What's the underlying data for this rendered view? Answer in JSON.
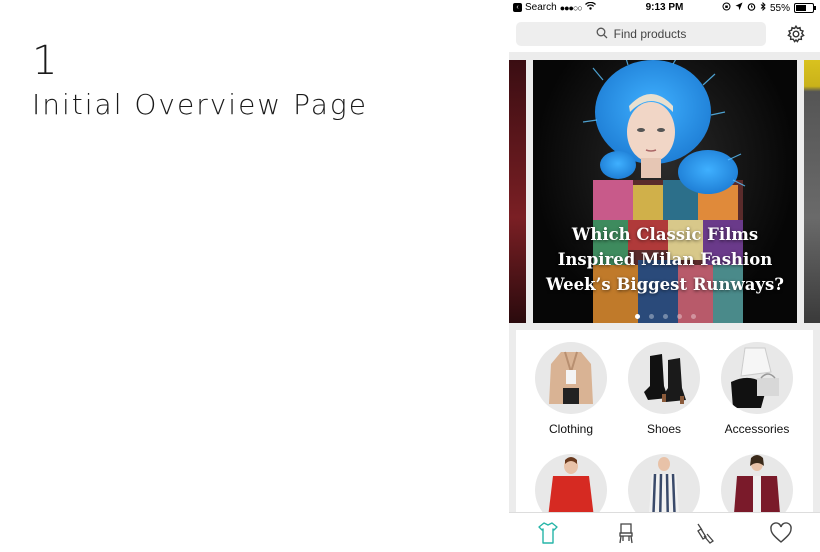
{
  "annotation": {
    "step_number": "1",
    "step_title": "Initial Overview Page"
  },
  "status_bar": {
    "back_app": "Search",
    "time": "9:13 PM",
    "battery": "55%",
    "battery_level": 0.55
  },
  "search": {
    "placeholder": "Find products"
  },
  "hero": {
    "caption_lines": [
      "Which Classic Films",
      "Inspired Milan Fashion",
      "Week’s Biggest Runways?"
    ],
    "page_count": 5,
    "active_page": 1
  },
  "categories": [
    {
      "label": "Clothing",
      "icon": "beige-coat"
    },
    {
      "label": "Shoes",
      "icon": "black-ankle-boots"
    },
    {
      "label": "Accessories",
      "icon": "handbag"
    },
    {
      "label": "",
      "icon": "red-sweater"
    },
    {
      "label": "",
      "icon": "striped-dress"
    },
    {
      "label": "",
      "icon": "burgundy-bomber-jacket"
    }
  ],
  "tabbar": {
    "items": [
      "clothing-tab",
      "furniture-tab",
      "beauty-tab",
      "favorites-tab"
    ],
    "active": "clothing-tab",
    "accent": "#26b5a8"
  }
}
